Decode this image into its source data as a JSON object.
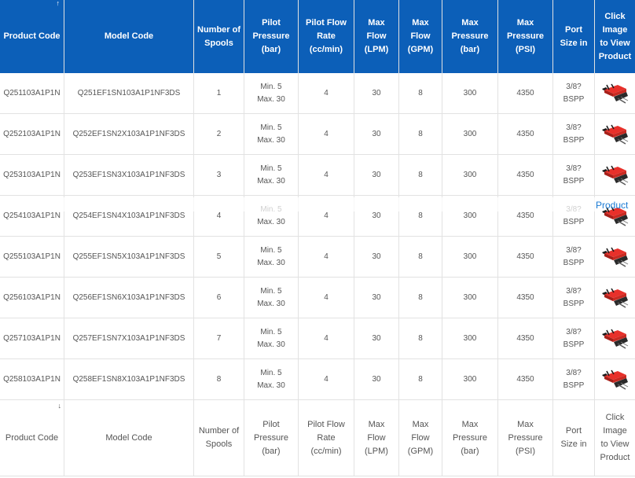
{
  "colors": {
    "header_bg": "#0c5fb8",
    "header_text": "#ffffff",
    "body_text": "#555555",
    "border": "#e2e2e2",
    "link": "#1a7ad4",
    "product_red": "#e8302a"
  },
  "icons": {
    "header_sort": "sort-up-icon",
    "footer_sort": "sort-down-icon",
    "product_image": "hydraulic-valve-image"
  },
  "table": {
    "columns": [
      "Product Code",
      "Model Code",
      "Number of\nSpools",
      "Pilot\nPressure\n(bar)",
      "Pilot Flow\nRate\n(cc/min)",
      "Max\nFlow\n(LPM)",
      "Max\nFlow\n(GPM)",
      "Max\nPressure\n(bar)",
      "Max\nPressure\n(PSI)",
      "Port\nSize in",
      "Click\nImage\nto View\nProduct"
    ],
    "rows": [
      {
        "product_code": "Q251103A1P1N",
        "model_code": "Q251EF1SN103A1P1NF3DS",
        "spools": "1",
        "pilot_pressure": "Min. 5\nMax. 30",
        "pilot_flow_rate": "4",
        "max_flow_lpm": "30",
        "max_flow_gpm": "8",
        "max_pressure_bar": "300",
        "max_pressure_psi": "4350",
        "port_size": "3/8?\nBSPP"
      },
      {
        "product_code": "Q252103A1P1N",
        "model_code": "Q252EF1SN2X103A1P1NF3DS",
        "spools": "2",
        "pilot_pressure": "Min. 5\nMax. 30",
        "pilot_flow_rate": "4",
        "max_flow_lpm": "30",
        "max_flow_gpm": "8",
        "max_pressure_bar": "300",
        "max_pressure_psi": "4350",
        "port_size": "3/8?\nBSPP"
      },
      {
        "product_code": "Q253103A1P1N",
        "model_code": "Q253EF1SN3X103A1P1NF3DS",
        "spools": "3",
        "pilot_pressure": "Min. 5\nMax. 30",
        "pilot_flow_rate": "4",
        "max_flow_lpm": "30",
        "max_flow_gpm": "8",
        "max_pressure_bar": "300",
        "max_pressure_psi": "4350",
        "port_size": "3/8?\nBSPP"
      },
      {
        "product_code": "Q254103A1P1N",
        "model_code": "Q254EF1SN4X103A1P1NF3DS",
        "spools": "4",
        "pilot_pressure": "Min. 5\nMax. 30",
        "pilot_flow_rate": "4",
        "max_flow_lpm": "30",
        "max_flow_gpm": "8",
        "max_pressure_bar": "300",
        "max_pressure_psi": "4350",
        "port_size": "3/8?\nBSPP",
        "image_alt": "Product"
      },
      {
        "product_code": "Q255103A1P1N",
        "model_code": "Q255EF1SN5X103A1P1NF3DS",
        "spools": "5",
        "pilot_pressure": "Min. 5\nMax. 30",
        "pilot_flow_rate": "4",
        "max_flow_lpm": "30",
        "max_flow_gpm": "8",
        "max_pressure_bar": "300",
        "max_pressure_psi": "4350",
        "port_size": "3/8?\nBSPP"
      },
      {
        "product_code": "Q256103A1P1N",
        "model_code": "Q256EF1SN6X103A1P1NF3DS",
        "spools": "6",
        "pilot_pressure": "Min. 5\nMax. 30",
        "pilot_flow_rate": "4",
        "max_flow_lpm": "30",
        "max_flow_gpm": "8",
        "max_pressure_bar": "300",
        "max_pressure_psi": "4350",
        "port_size": "3/8?\nBSPP"
      },
      {
        "product_code": "Q257103A1P1N",
        "model_code": "Q257EF1SN7X103A1P1NF3DS",
        "spools": "7",
        "pilot_pressure": "Min. 5\nMax. 30",
        "pilot_flow_rate": "4",
        "max_flow_lpm": "30",
        "max_flow_gpm": "8",
        "max_pressure_bar": "300",
        "max_pressure_psi": "4350",
        "port_size": "3/8?\nBSPP"
      },
      {
        "product_code": "Q258103A1P1N",
        "model_code": "Q258EF1SN8X103A1P1NF3DS",
        "spools": "8",
        "pilot_pressure": "Min. 5\nMax. 30",
        "pilot_flow_rate": "4",
        "max_flow_lpm": "30",
        "max_flow_gpm": "8",
        "max_pressure_bar": "300",
        "max_pressure_psi": "4350",
        "port_size": "3/8?\nBSPP"
      }
    ]
  }
}
